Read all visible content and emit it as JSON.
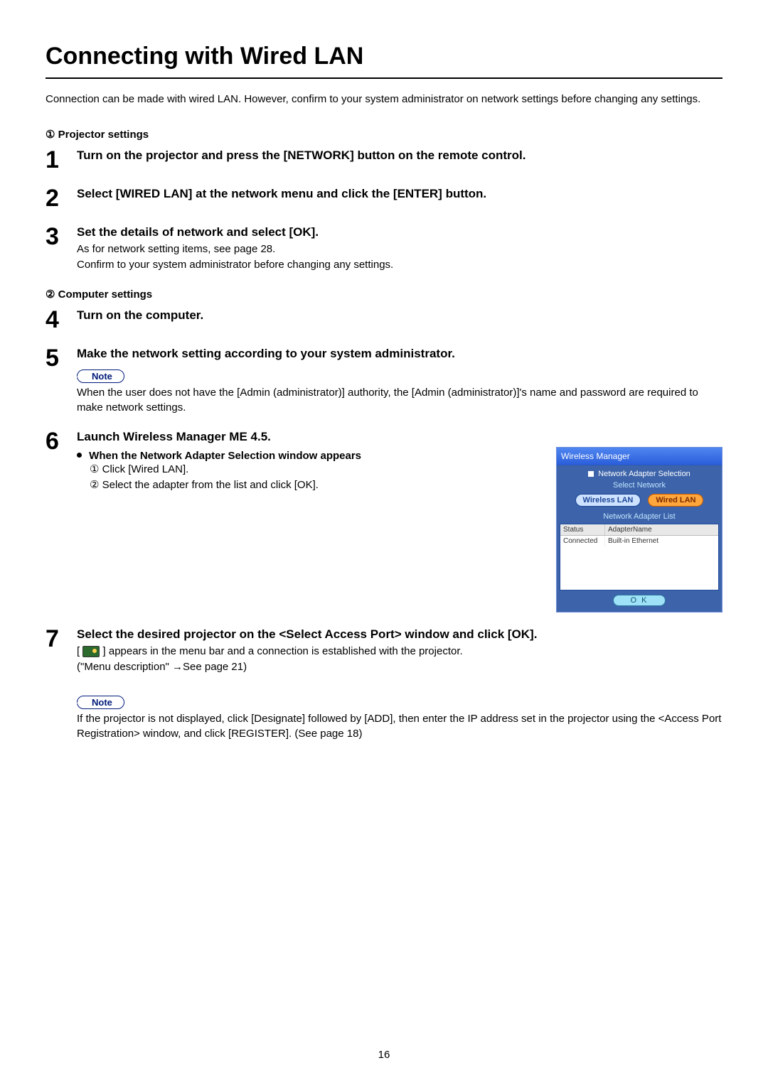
{
  "page_number": "16",
  "title": "Connecting with Wired LAN",
  "intro": "Connection can be made with wired LAN. However, confirm to your system administrator on network settings before changing any settings.",
  "section1_label": "① Projector settings",
  "section2_label": "② Computer settings",
  "steps": {
    "s1": {
      "num": "1",
      "head": "Turn on the projector and press the [NETWORK] button on the remote control."
    },
    "s2": {
      "num": "2",
      "head": "Select [WIRED LAN] at the network menu and click the [ENTER] button."
    },
    "s3": {
      "num": "3",
      "head": "Set the details of network and select [OK].",
      "sub1": "As for network setting items, see page 28.",
      "sub2": "Confirm to your system administrator before changing any settings."
    },
    "s4": {
      "num": "4",
      "head": "Turn on the computer."
    },
    "s5": {
      "num": "5",
      "head": "Make the network setting according to your system administrator.",
      "note_label": "Note",
      "note_text": "When the user does not have the [Admin (administrator)] authority, the [Admin (administrator)]'s name and password are required to make network settings."
    },
    "s6": {
      "num": "6",
      "head": "Launch Wireless Manager ME 4.5.",
      "bullet_head": "When the Network Adapter Selection window appears",
      "li1": "① Click [Wired LAN].",
      "li2": "② Select the adapter from the list and click [OK]."
    },
    "s7": {
      "num": "7",
      "head": "Select the desired projector on the <Select Access Port> window and click [OK].",
      "line1a": "[",
      "line1b": "] appears in the menu bar and a connection is established with the projector.",
      "line2": "(\"Menu description\" →See page 21)",
      "note_label": "Note",
      "note_text": "If the projector is not displayed, click [Designate] followed by [ADD], then enter the IP address set in the projector using the <Access Port Registration> window, and click [REGISTER]. (See page 18)"
    }
  },
  "wm": {
    "title": "Wireless Manager",
    "header": "Network Adapter Selection",
    "select_network": "Select Network",
    "tab_wireless": "Wireless LAN",
    "tab_wired": "Wired LAN",
    "list_label": "Network Adapter List",
    "col_status": "Status",
    "col_name": "AdapterName",
    "row_status": "Connected",
    "row_name": "Built-in Ethernet",
    "ok": "O K"
  }
}
